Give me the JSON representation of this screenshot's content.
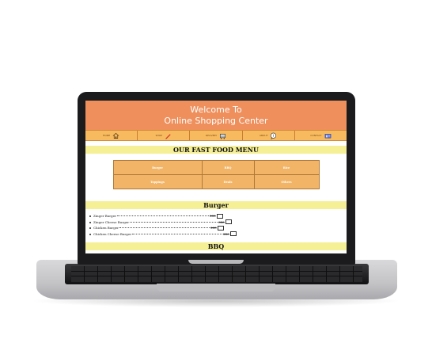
{
  "site": {
    "title_line1": "Welcome To",
    "title_line2": "Online Shopping Center"
  },
  "nav": [
    {
      "label": "HOME",
      "icon": "home-icon"
    },
    {
      "label": "SHOP",
      "icon": "pen-icon"
    },
    {
      "label": "DELIVERY",
      "icon": "cart-icon"
    },
    {
      "label": "ABOUT",
      "icon": "speech-bubble-icon"
    },
    {
      "label": "CONTACT",
      "icon": "contact-card-icon"
    }
  ],
  "menu": {
    "title": "OUR FAST FOOD MENU",
    "categories": [
      "Burger",
      "BBQ",
      "Rice",
      "Toppings",
      "Deals",
      "Others"
    ]
  },
  "burger_section": {
    "heading": "Burger",
    "items": [
      {
        "name": "Zinger Burger",
        "price": "300"
      },
      {
        "name": "Zinger Cheese Burger",
        "price": "350"
      },
      {
        "name": "Chicken Burger",
        "price": "200"
      },
      {
        "name": "Chicken Cheese Burger",
        "price": "250"
      }
    ]
  },
  "bbq_section": {
    "heading": "BBQ"
  },
  "colors": {
    "header": "#ee8f5c",
    "nav": "#f7ba5f",
    "band": "#f5ef96",
    "grid_cell": "#f2b466"
  }
}
